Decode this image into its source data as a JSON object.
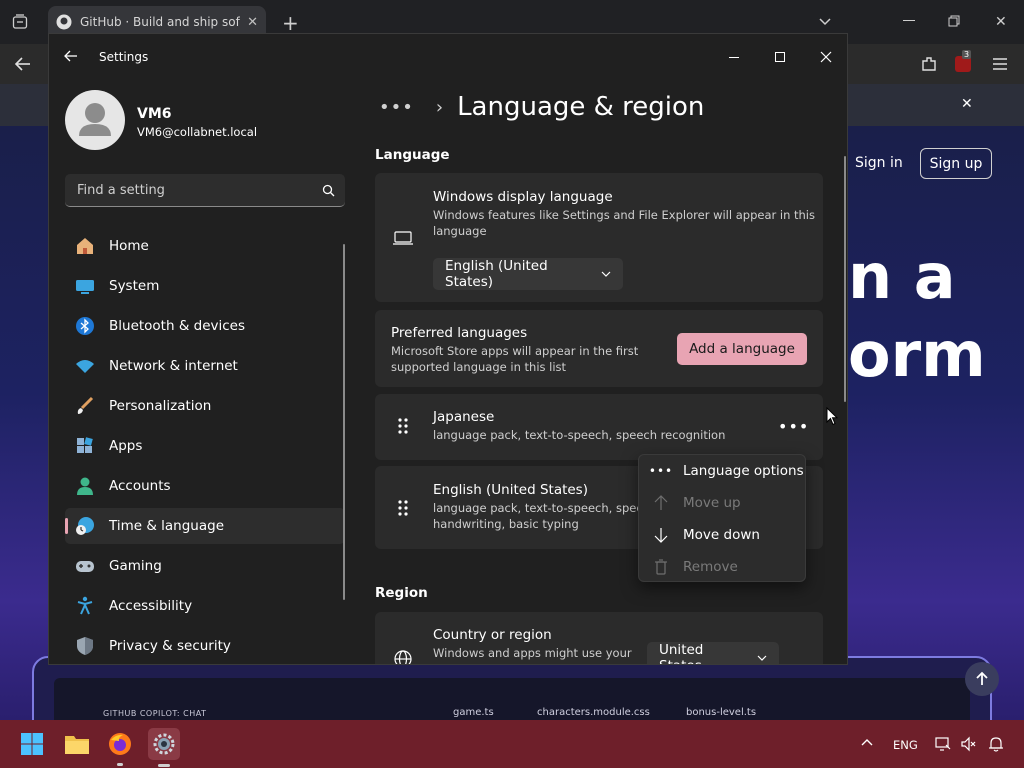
{
  "browser": {
    "tab_title": "GitHub · Build and ship software",
    "github": {
      "sign_in": "Sign in",
      "sign_up": "Sign up",
      "hero_line1": "n a",
      "hero_line2": "orm",
      "copilot_label": "GITHUB COPILOT: CHAT",
      "files": [
        "game.ts",
        "characters.module.css",
        "bonus-level.ts"
      ],
      "extension_badge": "3"
    }
  },
  "settings": {
    "window_title": "Settings",
    "profile": {
      "name": "VM6",
      "email": "VM6@collabnet.local"
    },
    "search_placeholder": "Find a setting",
    "nav": [
      {
        "label": "Home",
        "icon": "home-icon"
      },
      {
        "label": "System",
        "icon": "system-icon"
      },
      {
        "label": "Bluetooth & devices",
        "icon": "bluetooth-icon"
      },
      {
        "label": "Network & internet",
        "icon": "wifi-icon"
      },
      {
        "label": "Personalization",
        "icon": "brush-icon"
      },
      {
        "label": "Apps",
        "icon": "apps-icon"
      },
      {
        "label": "Accounts",
        "icon": "accounts-icon"
      },
      {
        "label": "Time & language",
        "icon": "time-language-icon",
        "active": true
      },
      {
        "label": "Gaming",
        "icon": "gamepad-icon"
      },
      {
        "label": "Accessibility",
        "icon": "accessibility-icon"
      },
      {
        "label": "Privacy & security",
        "icon": "shield-icon"
      }
    ],
    "page_title": "Language & region",
    "language_section": "Language",
    "display_language": {
      "title": "Windows display language",
      "desc_line1": "Windows features like Settings and File Explorer will appear in this",
      "desc_line2": "language",
      "value": "English (United States)"
    },
    "preferred": {
      "title": "Preferred languages",
      "desc_line1": "Microsoft Store apps will appear in the first",
      "desc_line2": "supported language in this list",
      "add_button": "Add a language"
    },
    "languages": [
      {
        "name": "Japanese",
        "features_line1": "language pack, text-to-speech, speech recognition",
        "features_line2": ""
      },
      {
        "name": "English (United States)",
        "features_line1": "language pack, text-to-speech, speech",
        "features_line2": "handwriting, basic typing"
      }
    ],
    "context_menu": [
      {
        "label": "Language options",
        "icon": "more-icon",
        "enabled": true
      },
      {
        "label": "Move up",
        "icon": "arrow-up-icon",
        "enabled": false
      },
      {
        "label": "Move down",
        "icon": "arrow-down-icon",
        "enabled": true
      },
      {
        "label": "Remove",
        "icon": "trash-icon",
        "enabled": false
      }
    ],
    "region_section": "Region",
    "country": {
      "title": "Country or region",
      "desc_line1": "Windows and apps might use your",
      "value": "United States"
    }
  },
  "taskbar": {
    "language": "ENG"
  },
  "colors": {
    "accent": "#e8a4b3",
    "taskbar": "#6e1f2a",
    "window_bg": "#202020",
    "card_bg": "#2b2b2b"
  }
}
